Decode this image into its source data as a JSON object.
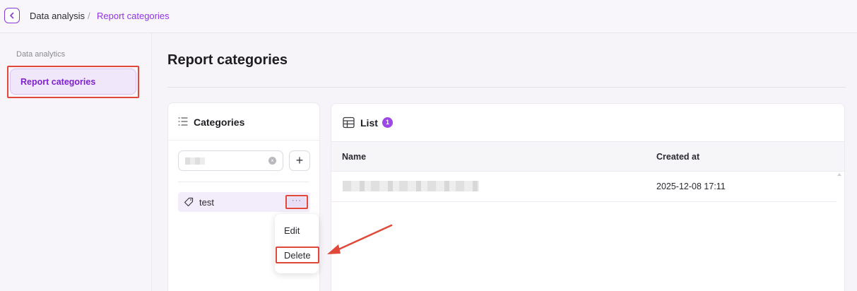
{
  "breadcrumb": {
    "parent": "Data analysis",
    "separator": "/",
    "current": "Report categories"
  },
  "sidebar": {
    "section_label": "Data analytics",
    "items": [
      {
        "label": "Report categories",
        "active": true
      }
    ]
  },
  "page": {
    "title": "Report categories"
  },
  "categories_panel": {
    "title": "Categories",
    "search": {
      "value_redacted": true
    },
    "add_label": "+",
    "items": [
      {
        "label": "test",
        "more_label": "···"
      }
    ],
    "menu": {
      "edit_label": "Edit",
      "delete_label": "Delete"
    }
  },
  "list_panel": {
    "title": "List",
    "count": "1",
    "columns": [
      "Name",
      "Created at"
    ],
    "rows": [
      {
        "name_redacted": true,
        "created_at": "2025-12-08 17:11"
      }
    ]
  },
  "colors": {
    "accent": "#9333ea",
    "highlight": "#e0483a",
    "badge": "#9b48e6"
  },
  "icons": [
    "chevron-left-icon",
    "list-icon",
    "clear-icon",
    "plus-icon",
    "tag-icon",
    "table-icon"
  ]
}
